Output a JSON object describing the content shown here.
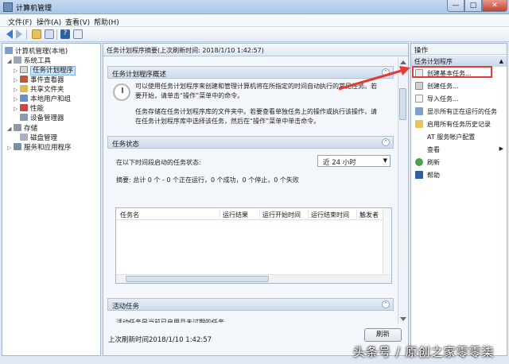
{
  "window": {
    "title": "计算机管理",
    "min": "—",
    "max": "□",
    "close": "✕"
  },
  "menu": [
    "文件(F)",
    "操作(A)",
    "查看(V)",
    "帮助(H)"
  ],
  "toolbar": {
    "help": "?"
  },
  "tree": {
    "root": "计算机管理(本地)",
    "system_tools": "系统工具",
    "task_scheduler": "任务计划程序",
    "event_viewer": "事件查看器",
    "shared_folders": "共享文件夹",
    "local_users": "本地用户和组",
    "performance": "性能",
    "device_manager": "设备管理器",
    "storage": "存储",
    "disk_mgmt": "磁盘管理",
    "services": "服务和应用程序"
  },
  "center": {
    "header": "任务计划程序摘要(上次刷新时间: 2018/1/10 1:42:57)",
    "overview_title": "任务计划程序概述",
    "overview_p1": "可以使用任务计划程序来创建和管理计算机将在所指定的时间自动执行的常见任务。若要开始，请单击“操作”菜单中的命令。",
    "overview_p2": "任务存储在任务计划程序库的文件夹中。若要查看单独任务上的操作或执行该操作，请在任务计划程序库中选择该任务，然后在“操作”菜单中单击命令。",
    "status_title": "任务状态",
    "status_label": "在以下时间段启动的任务状态:",
    "period": "近 24 小时",
    "summary": "摘要: 总计 0 个 - 0 个正在运行，0 个成功，0 个停止，0 个失败",
    "columns": [
      "任务名",
      "运行结果",
      "运行开始时间",
      "运行结束时间",
      "触发者"
    ],
    "active_title": "活动任务",
    "active_partial": "活动任务是当前已启用且未过期的任务。",
    "last_refresh": "上次刷新时间2018/1/10 1:42:57",
    "refresh_button": "刷新"
  },
  "actions": {
    "header": "操作",
    "group": "任务计划程序",
    "items": [
      {
        "label": "创建基本任务...",
        "icon": "create-basic-task-icon"
      },
      {
        "label": "创建任务...",
        "icon": "create-task-icon"
      },
      {
        "label": "导入任务...",
        "icon": "import-task-icon"
      },
      {
        "label": "显示所有正在运行的任务",
        "icon": "running-tasks-icon"
      },
      {
        "label": "启用所有任务历史记录",
        "icon": "history-icon"
      },
      {
        "label": "AT 服务帐户配置",
        "icon": "at-service-icon"
      },
      {
        "label": "查看",
        "icon": "view-icon"
      },
      {
        "label": "刷新",
        "icon": "refresh-icon"
      },
      {
        "label": "帮助",
        "icon": "help-icon"
      }
    ]
  },
  "watermark": "头条号 / 原创之家零零柒",
  "colors": {
    "highlight": "#e53a35",
    "selection": "#cde6fb"
  }
}
